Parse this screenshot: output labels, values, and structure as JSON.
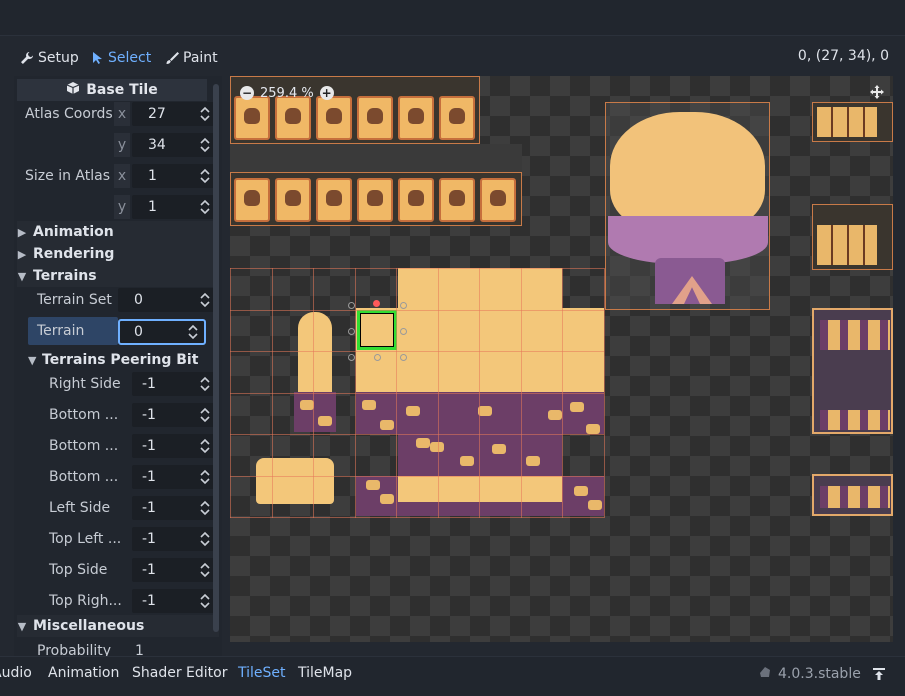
{
  "toolbar": {
    "setup_label": "Setup",
    "select_label": "Select",
    "paint_label": "Paint",
    "coords": "0, (27, 34), 0"
  },
  "inspector": {
    "base_tile_header": "Base Tile",
    "atlas_coords_label": "Atlas Coords",
    "atlas_x_axis": "x",
    "atlas_x": "27",
    "atlas_y_axis": "y",
    "atlas_y": "34",
    "size_label": "Size in Atlas",
    "size_x_axis": "x",
    "size_x": "1",
    "size_y_axis": "y",
    "size_y": "1",
    "animation_label": "Animation",
    "rendering_label": "Rendering",
    "terrains_label": "Terrains",
    "terrain_set_label": "Terrain Set",
    "terrain_set_value": "0",
    "terrain_label": "Terrain",
    "terrain_value": "0",
    "peering_label": "Terrains Peering Bit",
    "peering": [
      {
        "label": "Right Side",
        "value": "-1"
      },
      {
        "label": "Bottom ...",
        "value": "-1"
      },
      {
        "label": "Bottom ...",
        "value": "-1"
      },
      {
        "label": "Bottom ...",
        "value": "-1"
      },
      {
        "label": "Left Side",
        "value": "-1"
      },
      {
        "label": "Top Left ...",
        "value": "-1"
      },
      {
        "label": "Top Side",
        "value": "-1"
      },
      {
        "label": "Top Righ...",
        "value": "-1"
      }
    ],
    "misc_label": "Miscellaneous",
    "probability_label": "Probability",
    "probability_value": "1"
  },
  "viewport": {
    "zoom": "259.4 %"
  },
  "bottom_tabs": {
    "audio": "Audio",
    "animation": "Animation",
    "shader_editor": "Shader Editor",
    "tileset": "TileSet",
    "tilemap": "TileMap"
  },
  "version": "4.0.3.stable",
  "colors": {
    "accent": "#6fb0ff",
    "selection": "#33dd33",
    "sand": "#f3c77a",
    "purple": "#6c3e67"
  }
}
